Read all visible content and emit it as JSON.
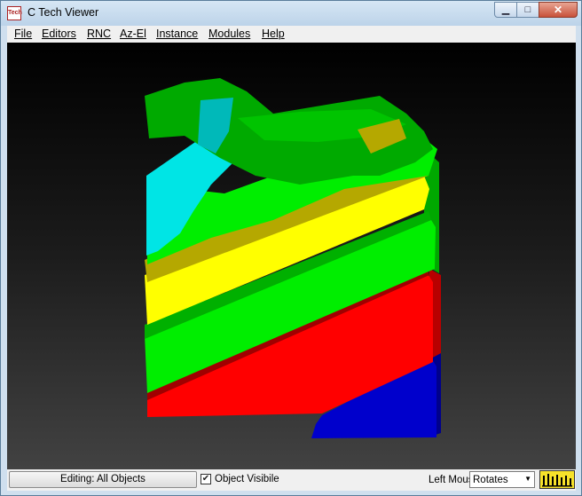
{
  "window": {
    "title": "C Tech Viewer",
    "icon_name": "ctech-app-icon",
    "icon_text": "Tech",
    "controls": {
      "minimize": "▁",
      "maximize": "□",
      "close": "✕"
    }
  },
  "menu": {
    "items": [
      {
        "label": "File"
      },
      {
        "label": "Editors"
      },
      {
        "label": "RNC"
      },
      {
        "label": "Az-El"
      },
      {
        "label": "Instance"
      },
      {
        "label": "Modules"
      },
      {
        "label": "Help"
      }
    ]
  },
  "viewport": {
    "background_top": "#000000",
    "background_bottom": "#424242",
    "model_layer_colors": [
      "#0000cc",
      "#ff0000",
      "#a00000",
      "#00ee00",
      "#ffff00",
      "#b5a800",
      "#00e5e5",
      "#00aa00"
    ]
  },
  "status": {
    "editing_label": "Editing: All Objects",
    "object_visible_label": "Object Visibile",
    "object_visible_checked": true,
    "left_mouse_label": "Left Mouse",
    "left_mouse_mode": "Rotates",
    "activity_meter_color": "#f7e22a"
  }
}
